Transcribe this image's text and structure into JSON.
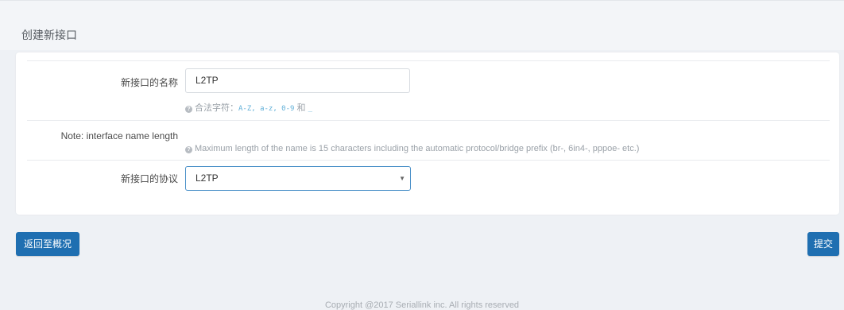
{
  "page": {
    "title": "创建新接口"
  },
  "form": {
    "name_label": "新接口的名称",
    "name_value": "L2TP",
    "name_hint_prefix": "合法字符：",
    "name_hint_chars": "A-Z, a-z, 0-9",
    "name_hint_and": "和",
    "name_hint_underscore": "_",
    "length_label": "Note: interface name length",
    "length_hint": "Maximum length of the name is 15 characters including the automatic protocol/bridge prefix (br-, 6in4-, pppoe- etc.)",
    "protocol_label": "新接口的协议",
    "protocol_value": "L2TP",
    "select_caret": "▼",
    "info_glyph": "?"
  },
  "actions": {
    "back_label": "返回至概况",
    "submit_label": "提交"
  },
  "footer": {
    "copyright": "Copyright @2017 Seriallink inc. All rights reserved"
  },
  "colors": {
    "accent": "#1f6fb1",
    "select_border": "#4a90c8",
    "background": "#eef1f5"
  }
}
